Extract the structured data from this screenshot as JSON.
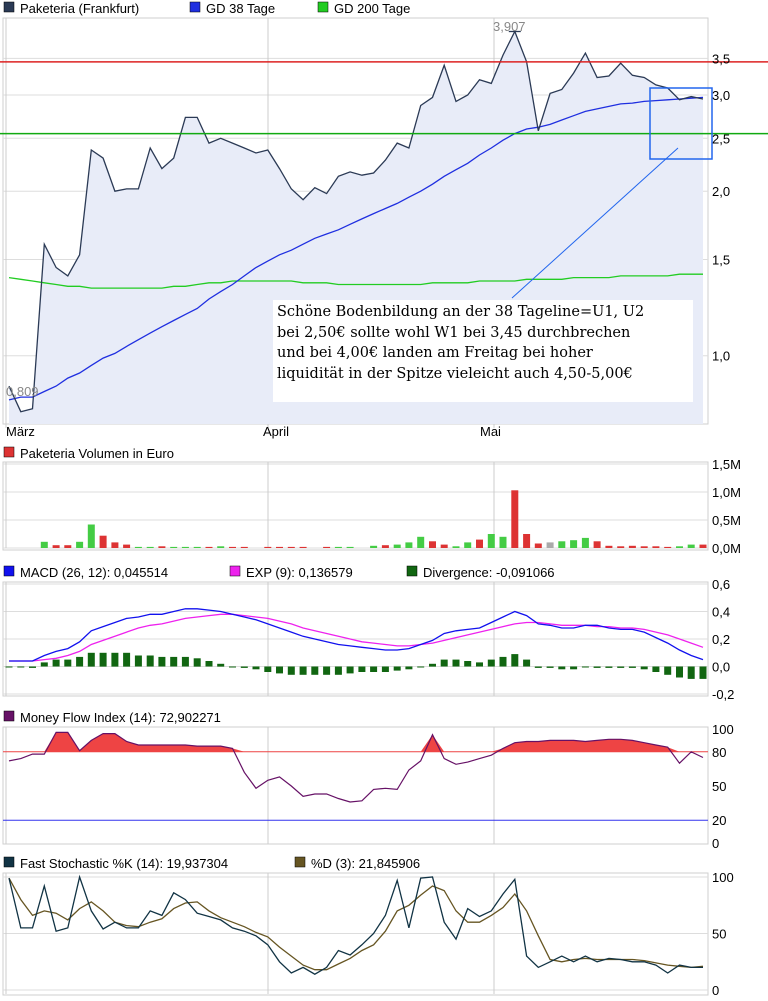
{
  "chart_data": [
    {
      "type": "line",
      "legend": [
        "Paketeria (Frankfurt)",
        "GD 38 Tage",
        "GD 200 Tage"
      ],
      "colors": {
        "price": "#2b3a55",
        "gd38": "#1f2fe0",
        "gd200": "#22cc22",
        "fill": "#e8ecf8",
        "resistance": "#dd2222",
        "support": "#11aa11",
        "box": "#2266ee"
      },
      "xlabels": [
        "März",
        "April",
        "Mai"
      ],
      "y_ticks": [
        "3,5",
        "3,0",
        "2,5",
        "2,0",
        "1,5",
        "1,0"
      ],
      "y_scale": "log",
      "ylim": [
        0.75,
        4.15
      ],
      "high_label": "3,907",
      "low_label": "0,809",
      "resistance": 3.45,
      "support": 2.55,
      "price": [
        0.88,
        0.79,
        0.8,
        1.6,
        1.45,
        1.4,
        1.53,
        2.38,
        2.3,
        2.0,
        2.02,
        2.02,
        2.4,
        2.2,
        2.3,
        2.73,
        2.73,
        2.45,
        2.5,
        2.45,
        2.4,
        2.35,
        2.38,
        2.2,
        2.02,
        1.93,
        2.03,
        1.98,
        2.13,
        2.17,
        2.14,
        2.16,
        2.28,
        2.45,
        2.4,
        2.87,
        2.97,
        3.4,
        2.92,
        3.0,
        3.2,
        3.15,
        3.55,
        3.92,
        3.45,
        2.58,
        3.02,
        3.07,
        3.29,
        3.58,
        3.23,
        3.25,
        3.43,
        3.26,
        3.23,
        3.13,
        3.09,
        2.94,
        2.98,
        2.95
      ],
      "gd38": [
        0.83,
        0.84,
        0.84,
        0.86,
        0.88,
        0.91,
        0.93,
        0.96,
        0.99,
        1.01,
        1.04,
        1.07,
        1.1,
        1.13,
        1.16,
        1.19,
        1.22,
        1.27,
        1.31,
        1.35,
        1.4,
        1.45,
        1.49,
        1.53,
        1.56,
        1.6,
        1.64,
        1.67,
        1.7,
        1.74,
        1.78,
        1.82,
        1.86,
        1.9,
        1.95,
        2.0,
        2.06,
        2.13,
        2.19,
        2.25,
        2.33,
        2.4,
        2.48,
        2.55,
        2.6,
        2.62,
        2.65,
        2.7,
        2.75,
        2.8,
        2.83,
        2.86,
        2.89,
        2.9,
        2.92,
        2.93,
        2.94,
        2.95,
        2.96,
        2.97
      ],
      "gd200": [
        1.39,
        1.38,
        1.37,
        1.36,
        1.35,
        1.34,
        1.34,
        1.33,
        1.33,
        1.33,
        1.33,
        1.33,
        1.33,
        1.33,
        1.34,
        1.34,
        1.35,
        1.36,
        1.36,
        1.37,
        1.37,
        1.37,
        1.37,
        1.37,
        1.37,
        1.36,
        1.36,
        1.36,
        1.35,
        1.35,
        1.35,
        1.35,
        1.35,
        1.35,
        1.35,
        1.35,
        1.36,
        1.36,
        1.36,
        1.36,
        1.37,
        1.37,
        1.37,
        1.37,
        1.38,
        1.38,
        1.38,
        1.38,
        1.39,
        1.39,
        1.39,
        1.39,
        1.4,
        1.4,
        1.4,
        1.4,
        1.4,
        1.41,
        1.41,
        1.41
      ]
    },
    {
      "type": "bar",
      "legend": [
        "Paketeria Volumen in Euro"
      ],
      "y_ticks": [
        "1,5M",
        "1,0M",
        "0,5M",
        "0,0M"
      ],
      "ylim": [
        0,
        1.5
      ],
      "up_color": "#44cc44",
      "down_color": "#dd3333",
      "flat_color": "#aaaaaa",
      "values": [
        0,
        0,
        0,
        0.11,
        0.05,
        0.05,
        0.11,
        0.42,
        0.22,
        0.1,
        0.06,
        0.02,
        0.02,
        0.03,
        0.02,
        0.02,
        0.02,
        0.02,
        0.03,
        0.02,
        0.02,
        0,
        0.02,
        0.02,
        0.02,
        0.02,
        0,
        0.02,
        0.02,
        0.02,
        0,
        0.04,
        0.05,
        0.06,
        0.1,
        0.2,
        0.12,
        0.06,
        0.03,
        0.1,
        0.15,
        0.25,
        0.2,
        1.03,
        0.25,
        0.08,
        0.1,
        0.12,
        0.14,
        0.18,
        0.12,
        0.04,
        0.03,
        0.04,
        0.03,
        0.03,
        0.02,
        0.03,
        0.06,
        0.06
      ],
      "direction": [
        "u",
        "u",
        "u",
        "u",
        "d",
        "d",
        "u",
        "u",
        "d",
        "d",
        "d",
        "u",
        "u",
        "d",
        "u",
        "u",
        "u",
        "d",
        "u",
        "d",
        "d",
        "u",
        "d",
        "d",
        "d",
        "d",
        "u",
        "d",
        "u",
        "u",
        "d",
        "u",
        "d",
        "u",
        "u",
        "u",
        "d",
        "d",
        "u",
        "u",
        "d",
        "u",
        "u",
        "d",
        "d",
        "d",
        "x",
        "u",
        "u",
        "u",
        "d",
        "d",
        "d",
        "d",
        "d",
        "d",
        "d",
        "u",
        "u",
        "d"
      ]
    },
    {
      "type": "line",
      "legend": [
        "MACD (26, 12): 0,045514",
        "EXP (9): 0,136579",
        "Divergence: -0,091066"
      ],
      "colors": {
        "macd": "#1111ee",
        "exp": "#ee22ee",
        "div": "#116611"
      },
      "y_ticks": [
        "0,6",
        "0,4",
        "0,2",
        "0,0",
        "-0,2"
      ],
      "ylim": [
        -0.2,
        0.6
      ],
      "macd": [
        0.04,
        0.04,
        0.04,
        0.08,
        0.11,
        0.13,
        0.18,
        0.26,
        0.29,
        0.32,
        0.35,
        0.36,
        0.38,
        0.38,
        0.4,
        0.42,
        0.42,
        0.41,
        0.4,
        0.38,
        0.36,
        0.34,
        0.31,
        0.28,
        0.25,
        0.22,
        0.2,
        0.18,
        0.16,
        0.15,
        0.14,
        0.13,
        0.12,
        0.12,
        0.13,
        0.16,
        0.19,
        0.24,
        0.26,
        0.27,
        0.28,
        0.32,
        0.36,
        0.4,
        0.37,
        0.31,
        0.3,
        0.28,
        0.28,
        0.3,
        0.3,
        0.28,
        0.27,
        0.27,
        0.25,
        0.21,
        0.17,
        0.12,
        0.08,
        0.05
      ],
      "exp": [
        0.04,
        0.04,
        0.04,
        0.05,
        0.06,
        0.08,
        0.11,
        0.16,
        0.19,
        0.22,
        0.25,
        0.28,
        0.3,
        0.31,
        0.33,
        0.35,
        0.36,
        0.37,
        0.38,
        0.38,
        0.37,
        0.36,
        0.35,
        0.33,
        0.31,
        0.28,
        0.26,
        0.24,
        0.22,
        0.2,
        0.18,
        0.17,
        0.16,
        0.15,
        0.15,
        0.16,
        0.17,
        0.19,
        0.21,
        0.23,
        0.25,
        0.27,
        0.29,
        0.31,
        0.32,
        0.32,
        0.31,
        0.3,
        0.3,
        0.3,
        0.29,
        0.29,
        0.28,
        0.28,
        0.27,
        0.25,
        0.23,
        0.2,
        0.17,
        0.14
      ],
      "divergence": [
        0.0,
        0.0,
        -0.01,
        0.03,
        0.05,
        0.05,
        0.07,
        0.1,
        0.1,
        0.1,
        0.1,
        0.08,
        0.08,
        0.07,
        0.07,
        0.07,
        0.06,
        0.04,
        0.02,
        0.0,
        -0.01,
        -0.02,
        -0.04,
        -0.05,
        -0.06,
        -0.06,
        -0.06,
        -0.06,
        -0.06,
        -0.05,
        -0.04,
        -0.04,
        -0.04,
        -0.03,
        -0.02,
        0.0,
        0.02,
        0.05,
        0.05,
        0.04,
        0.03,
        0.05,
        0.07,
        0.09,
        0.05,
        -0.01,
        -0.01,
        -0.02,
        -0.02,
        0.0,
        -0.01,
        -0.01,
        -0.01,
        -0.01,
        -0.02,
        -0.04,
        -0.06,
        -0.08,
        -0.09,
        -0.09
      ]
    },
    {
      "type": "area",
      "legend": [
        "Money Flow Index (14): 72,902271"
      ],
      "colors": {
        "line": "#661166",
        "fill": "#ee4444",
        "upper": "#ee4444",
        "lower": "#3333ee"
      },
      "y_ticks": [
        "100",
        "80",
        "50",
        "20",
        "0"
      ],
      "ylim": [
        0,
        100
      ],
      "levels": [
        80,
        20
      ],
      "values": [
        72,
        74,
        78,
        78,
        97,
        97,
        81,
        90,
        96,
        96,
        89,
        86,
        86,
        86,
        86,
        86,
        85,
        85,
        85,
        83,
        62,
        48,
        55,
        58,
        50,
        41,
        43,
        43,
        39,
        36,
        37,
        47,
        48,
        47,
        64,
        72,
        95,
        74,
        69,
        71,
        74,
        77,
        83,
        88,
        89,
        89,
        90,
        90,
        90,
        89,
        90,
        91,
        91,
        90,
        88,
        86,
        84,
        70,
        80,
        75
      ]
    },
    {
      "type": "line",
      "legend": [
        "Fast Stochastic %K (14): 19,937304",
        "%D (3): 21,845906"
      ],
      "colors": {
        "k": "#113344",
        "d": "#665522"
      },
      "y_ticks": [
        "100",
        "50",
        "0"
      ],
      "ylim": [
        0,
        100
      ],
      "k": [
        99,
        55,
        55,
        92,
        52,
        55,
        100,
        70,
        54,
        60,
        55,
        55,
        70,
        66,
        86,
        80,
        68,
        65,
        62,
        55,
        52,
        48,
        40,
        25,
        15,
        20,
        14,
        20,
        35,
        31,
        40,
        50,
        66,
        97,
        55,
        99,
        100,
        60,
        45,
        72,
        65,
        70,
        85,
        98,
        30,
        20,
        25,
        30,
        25,
        30,
        25,
        28,
        27,
        25,
        25,
        22,
        15,
        22,
        20,
        20
      ],
      "d": [
        99,
        80,
        66,
        70,
        68,
        62,
        72,
        78,
        70,
        60,
        57,
        56,
        60,
        63,
        72,
        77,
        78,
        70,
        64,
        60,
        56,
        51,
        47,
        38,
        30,
        22,
        18,
        18,
        23,
        28,
        35,
        40,
        52,
        70,
        75,
        84,
        92,
        88,
        70,
        60,
        60,
        66,
        73,
        85,
        70,
        48,
        27,
        25,
        27,
        28,
        27,
        27,
        27,
        27,
        26,
        24,
        22,
        21,
        20,
        21
      ]
    }
  ],
  "annotation": {
    "lines": [
      "Schöne Bodenbildung an der 38 Tageline=U1, U2",
      "bei 2,50€ sollte wohl W1 bei 3,45 durchbrechen",
      "und bei 4,00€ landen am Freitag bei hoher",
      "liquidität in der Spitze vieleicht auch 4,50-5,00€"
    ]
  }
}
